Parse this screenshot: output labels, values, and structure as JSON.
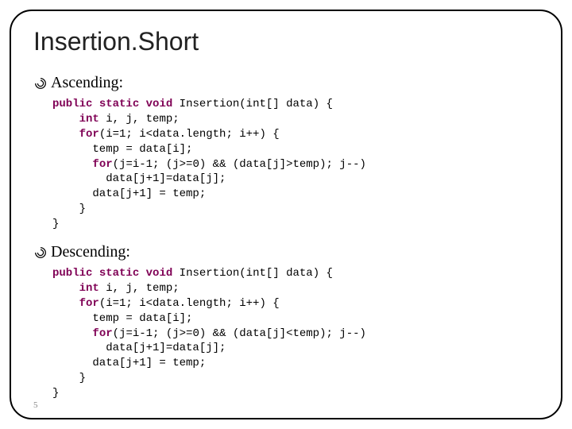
{
  "title": "Insertion.Short",
  "sections": {
    "asc": {
      "label": "Ascending:"
    },
    "desc": {
      "label": "Descending:"
    }
  },
  "code": {
    "kw_public": "public",
    "kw_static": "static",
    "kw_void": "void",
    "kw_int_arr": "int",
    "kw_int": "int",
    "kw_for1": "for",
    "kw_for2": "for",
    "sig_tail": " Insertion(int[] data) {",
    "decl_tail": " i, j, temp;",
    "for1_tail": "(i=1; i<data.length; i++) {",
    "assign_temp": "      temp = data[i];",
    "for2_asc_tail": "(j=i-1; (j>=0) && (data[j]>temp); j--)",
    "for2_desc_tail": "(j=i-1; (j>=0) && (data[j]<temp); j--)",
    "shift": "        data[j+1]=data[j];",
    "place": "      data[j+1] = temp;",
    "close_inner": "    }",
    "close_outer": "}"
  },
  "page_number": "5"
}
